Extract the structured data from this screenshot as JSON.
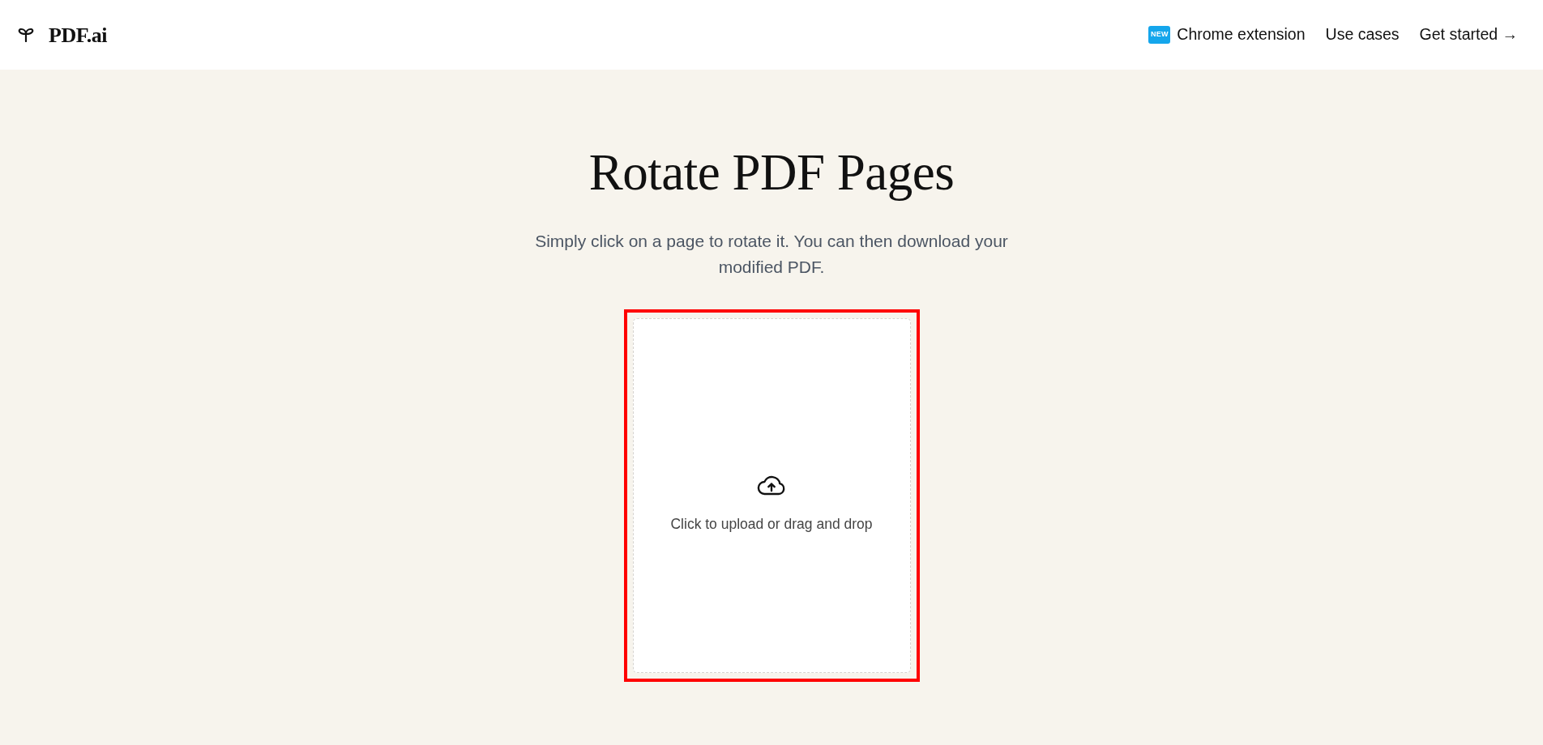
{
  "header": {
    "logo": {
      "text": "PDF.ai"
    },
    "nav": [
      {
        "kind": "badge-link",
        "badge": "NEW",
        "label": "Chrome extension"
      },
      {
        "kind": "link",
        "label": "Use cases"
      },
      {
        "kind": "cta",
        "label": "Get started →"
      }
    ]
  },
  "hero": {
    "title": "Rotate PDF Pages",
    "subtitle": "Simply click on a page to rotate it. You can then download your modified PDF."
  },
  "upload": {
    "label": "Click to upload or drag and drop",
    "highlighted": true
  }
}
